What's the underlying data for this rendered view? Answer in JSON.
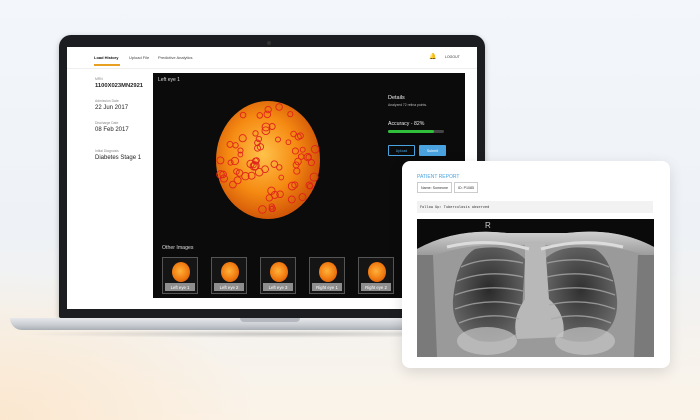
{
  "nav": {
    "items": [
      "Load History",
      "Upload File",
      "Predictive Analytics"
    ],
    "logout": "LOGOUT"
  },
  "patient_info": {
    "mrn_label": "MRN",
    "mrn": "1100X023MN2921",
    "admission_label": "Admission Date",
    "admission": "22 Jun 2017",
    "discharge_label": "Discharge Date",
    "discharge": "08 Feb 2017",
    "diagnosis_label": "Initial Diagnosis",
    "diagnosis": "Diabetes Stage 1"
  },
  "viewer": {
    "title": "Left eye 1",
    "details_title": "Details",
    "details_sub": "Analyzed 72 retina points.",
    "accuracy_label": "Accuracy - 82%",
    "accuracy": 0.82,
    "upload_label": "Upload",
    "submit_label": "Submit",
    "other_images_title": "Other Images",
    "thumbnails": [
      "Left eye 1",
      "Left eye 2",
      "Left eye 3",
      "Right eye 1",
      "Right eye 2"
    ]
  },
  "report": {
    "title": "PATIENT REPORT",
    "name_chip": "Name: Someone",
    "id_chip": "ID: P1085",
    "followup": "Follow Up: Tuberculosis observed",
    "xray_marker": "R"
  },
  "colors": {
    "accent_blue": "#4aa3df",
    "accuracy_green": "#2fbf3a",
    "nav_underline": "#e8a020",
    "marker_red": "#e0241b"
  },
  "icons": {
    "bell": "bell-icon"
  }
}
